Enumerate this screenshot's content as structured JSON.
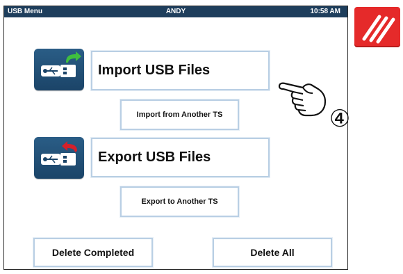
{
  "status_bar": {
    "screen_title": "USB Menu",
    "user": "ANDY",
    "time": "10:58 AM"
  },
  "actions": {
    "import_usb": "Import USB Files",
    "import_ts": "Import from Another TS",
    "export_usb": "Export USB Files",
    "export_ts": "Export to Another TS",
    "delete_completed": "Delete Completed",
    "delete_all": "Delete All"
  },
  "icons": {
    "import": "usb-import-icon",
    "export": "usb-export-icon",
    "estop": "emergency-stop-icon",
    "pointer": "pointing-hand-icon"
  },
  "callout": {
    "number": "④"
  },
  "colors": {
    "status_bar": "#1e3e5c",
    "button_border": "#b9cfe4",
    "icon_bg": "#1b4468",
    "import_arrow": "#3fbf3f",
    "export_arrow": "#d6202a",
    "estop": "#e52a2a"
  }
}
